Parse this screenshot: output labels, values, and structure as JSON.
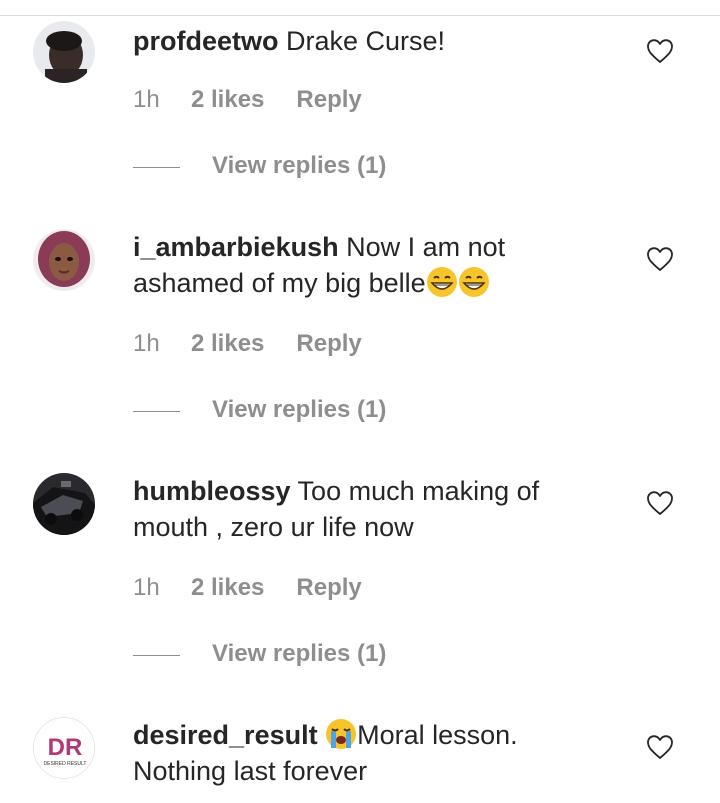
{
  "comments": [
    {
      "username": "profdeetwo",
      "text": " Drake Curse!",
      "time": "1h",
      "likes": "2 likes",
      "reply": "Reply",
      "view_replies": "View replies (1)",
      "avatar": "avatar-dark-man"
    },
    {
      "username": "i_ambarbiekush",
      "text": " Now I am not ashamed of my big belle",
      "emoji": [
        "grinning-face",
        "grinning-face"
      ],
      "time": "1h",
      "likes": "2 likes",
      "reply": "Reply",
      "view_replies": "View replies (1)",
      "avatar": "avatar-woman-pink-hair"
    },
    {
      "username": "humbleossy",
      "text": " Too much making of mouth , zero ur life now",
      "time": "1h",
      "likes": "2 likes",
      "reply": "Reply",
      "view_replies": "View replies (1)",
      "avatar": "avatar-dark-car"
    },
    {
      "username": "desired_result",
      "text": "Moral lesson. Nothing last forever",
      "emoji_before": "loudly-crying-face",
      "avatar": "avatar-dr-logo",
      "logo_text": "DR",
      "logo_subtext": "DESIRED RESULT"
    }
  ],
  "icons": {
    "like": "heart-outline-icon"
  },
  "colors": {
    "text": "#262626",
    "muted": "#8e8e8e",
    "divider": "#dbdbdb"
  }
}
